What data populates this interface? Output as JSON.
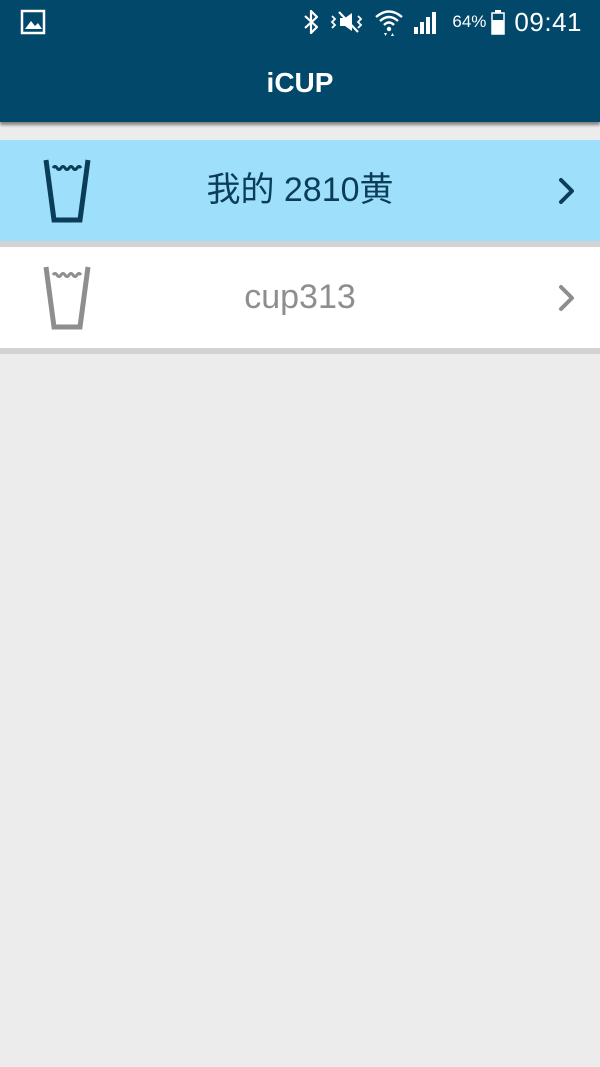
{
  "status_bar": {
    "battery_percent": "64%",
    "time": "09:41",
    "icons": [
      "gallery-icon",
      "bluetooth-icon",
      "mute-icon",
      "wifi-icon",
      "signal-icon",
      "battery-icon"
    ]
  },
  "app_bar": {
    "title": "iCUP"
  },
  "cups": [
    {
      "name": "我的 2810黄",
      "selected": true,
      "icon": "cup-icon"
    },
    {
      "name": "cup313",
      "selected": false,
      "icon": "cup-icon"
    }
  ],
  "colors": {
    "header": "#02486b",
    "selected_row": "#9ee0fb",
    "selected_text": "#0b3d58",
    "normal_text": "#8e8e8e",
    "background": "#ececec"
  }
}
